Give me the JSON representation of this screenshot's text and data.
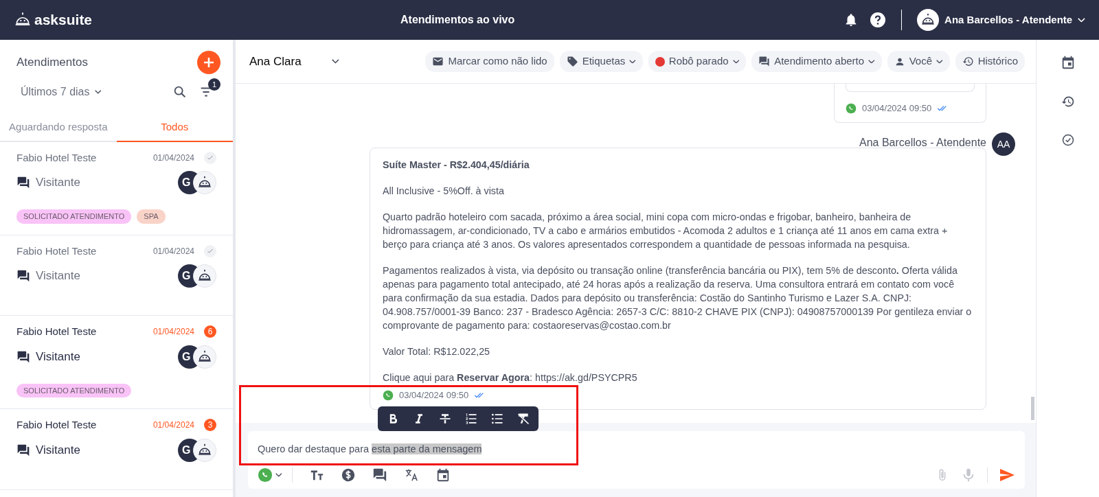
{
  "topbar": {
    "logo_text": "asksuite",
    "title": "Atendimentos ao vivo",
    "user_name": "Ana Barcellos - Atendente"
  },
  "sidebar": {
    "title": "Atendimentos",
    "period": "Últimos 7 dias",
    "filter_count": "1",
    "tabs": [
      {
        "label": "Aguardando resposta",
        "selected": false
      },
      {
        "label": "Todos",
        "selected": true
      }
    ],
    "conversations": [
      {
        "name": "Fabio Hotel Teste",
        "date": "01/04/2024",
        "unread": false,
        "channel": "Visitante",
        "agent_initial": "G",
        "tags": [
          {
            "label": "SOLICITADO ATENDIMENTO",
            "color": "#f9c3f7"
          },
          {
            "label": "SPA",
            "color": "#f9d3c8"
          }
        ]
      },
      {
        "name": "Fabio Hotel Teste",
        "date": "01/04/2024",
        "unread": false,
        "channel": "Visitante",
        "agent_initial": "G"
      },
      {
        "name": "Fabio Hotel Teste",
        "date": "01/04/2024",
        "unread": true,
        "count": "6",
        "channel": "Visitante",
        "agent_initial": "G",
        "tags": [
          {
            "label": "SOLICITADO ATENDIMENTO",
            "color": "#f9c3f7"
          }
        ]
      },
      {
        "name": "Fabio Hotel Teste",
        "date": "01/04/2024",
        "unread": true,
        "count": "3",
        "channel": "Visitante",
        "agent_initial": "G"
      }
    ]
  },
  "chat": {
    "contact": "Ana Clara",
    "actions": [
      {
        "kind": "mail",
        "label": "Marcar como não lido",
        "dropdown": false
      },
      {
        "kind": "tag",
        "label": "Etiquetas",
        "dropdown": true
      },
      {
        "kind": "dot",
        "label": "Robô parado",
        "dropdown": true,
        "color": "#e53935"
      },
      {
        "kind": "chat",
        "label": "Atendimento aberto",
        "dropdown": true
      },
      {
        "kind": "person",
        "label": "Você",
        "dropdown": true
      },
      {
        "kind": "history",
        "label": "Histórico",
        "dropdown": false
      }
    ],
    "previous_message": {
      "time": "03/04/2024 09:50",
      "read": true
    },
    "message": {
      "sender": "Ana Barcellos - Atendente",
      "avatar": "AA",
      "time": "03/04/2024 09:50",
      "read": true,
      "paragraphs": [
        {
          "kind": "title",
          "text": "Suíte Master - R$2.404,45/diária"
        },
        {
          "kind": "text",
          "text": "All Inclusive - 5%Off. à vista"
        },
        {
          "kind": "text",
          "text": "Quarto padrão hoteleiro com sacada, próximo a área social, mini copa com micro-ondas e frigobar, banheiro, banheira de hidromassagem, ar-condicionado, TV a cabo e armários embutidos - Acomoda 2 adultos e 1 criança até 11 anos em cama extra + berço para criança até 3 anos. Os valores apresentados correspondem a quantidade de pessoas informada na pesquisa."
        },
        {
          "kind": "text",
          "text": "Pagamentos realizados à vista, via depósito ou transação online (transferência bancária ou PIX), tem 5% de desconto**.** Oferta válida apenas para pagamento total antecipado, até 24 horas após a realização da reserva. Uma consultora entrará em contato com você para confirmação da sua estadia. Dados para depósito ou transferência: Costão do Santinho Turismo e Lazer S.A. CNPJ: 04.908.757/0001-39 Banco: 237 - Bradesco Agência: 2657-3 C/C: 8810-2 CHAVE PIX (CNPJ): 04908757000139 Por gentileza enviar o comprovante de pagamento para: costaoreservas@costao.com.br"
        },
        {
          "kind": "text",
          "text": "Valor Total: R$12.022,25"
        },
        {
          "kind": "text",
          "text": "Clique aqui para **Reservar Agora**: https://ak.gd/PSYCPR5"
        }
      ]
    },
    "composer": {
      "text": "Quero dar destaque para ",
      "selected_text": "esta parte da mensagem",
      "highlighted": true
    }
  }
}
